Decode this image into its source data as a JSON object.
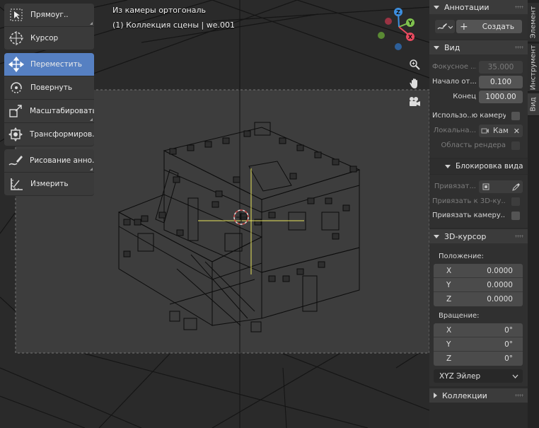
{
  "viewport": {
    "view_name": "Из камеры ортогональ",
    "collection_label": "(1) Коллекция сцены | we.001"
  },
  "toolbar": {
    "items": [
      {
        "label": "Прямоуг..",
        "icon": "select-box-icon",
        "active": false
      },
      {
        "label": "Курсор",
        "icon": "cursor-icon",
        "active": false
      },
      {
        "label": "Переместить",
        "icon": "move-icon",
        "active": true
      },
      {
        "label": "Повернуть",
        "icon": "rotate-icon",
        "active": false
      },
      {
        "label": "Масштабировать",
        "icon": "scale-icon",
        "active": false
      },
      {
        "label": "Трансформиров..",
        "icon": "transform-icon",
        "active": false
      },
      {
        "label": "Рисование анно..",
        "icon": "annotate-icon",
        "active": false
      },
      {
        "label": "Измерить",
        "icon": "measure-icon",
        "active": false
      }
    ]
  },
  "gizmo": {
    "z_label": "Z",
    "y_label": "Y",
    "x_label": "X",
    "colors": {
      "x": "#e84a5f",
      "y": "#7fc24e",
      "z": "#3d8fe0",
      "neg_x": "#9a3343",
      "neg_y": "#5a8a34",
      "neg_z": "#2d5f99"
    }
  },
  "tabs": {
    "items": [
      "Элемент",
      "Инструмент",
      "Вид"
    ],
    "active": "Вид"
  },
  "sidebar": {
    "annotations": {
      "title": "Аннотации",
      "create_label": "Создать"
    },
    "view": {
      "title": "Вид",
      "focal_label": "Фокусное ...",
      "focal_value": "35.000",
      "clip_start_label": "Начало от...",
      "clip_start_value": "0.100",
      "clip_end_label": "Конец",
      "clip_end_value": "1000.00",
      "use_camera_label": "Использо..ю камеру",
      "local_label": "Локальна...",
      "local_value": "Кам",
      "render_region_label": "Область рендера"
    },
    "view_lock": {
      "title": "Блокировка вида",
      "lock_to_label": "Привязат...",
      "lock_to_3d_label": "Привязать к 3D-ку...",
      "lock_camera_label": "Привязать камеру..."
    },
    "cursor": {
      "title": "3D-курсор",
      "location_label": "Положение:",
      "location": [
        {
          "axis": "X",
          "value": "0.0000"
        },
        {
          "axis": "Y",
          "value": "0.0000"
        },
        {
          "axis": "Z",
          "value": "0.0000"
        }
      ],
      "rotation_label": "Вращение:",
      "rotation": [
        {
          "axis": "X",
          "value": "0°"
        },
        {
          "axis": "Y",
          "value": "0°"
        },
        {
          "axis": "Z",
          "value": "0°"
        }
      ],
      "rotation_mode": "XYZ Эйлер"
    },
    "collections": {
      "title": "Коллекции"
    }
  }
}
